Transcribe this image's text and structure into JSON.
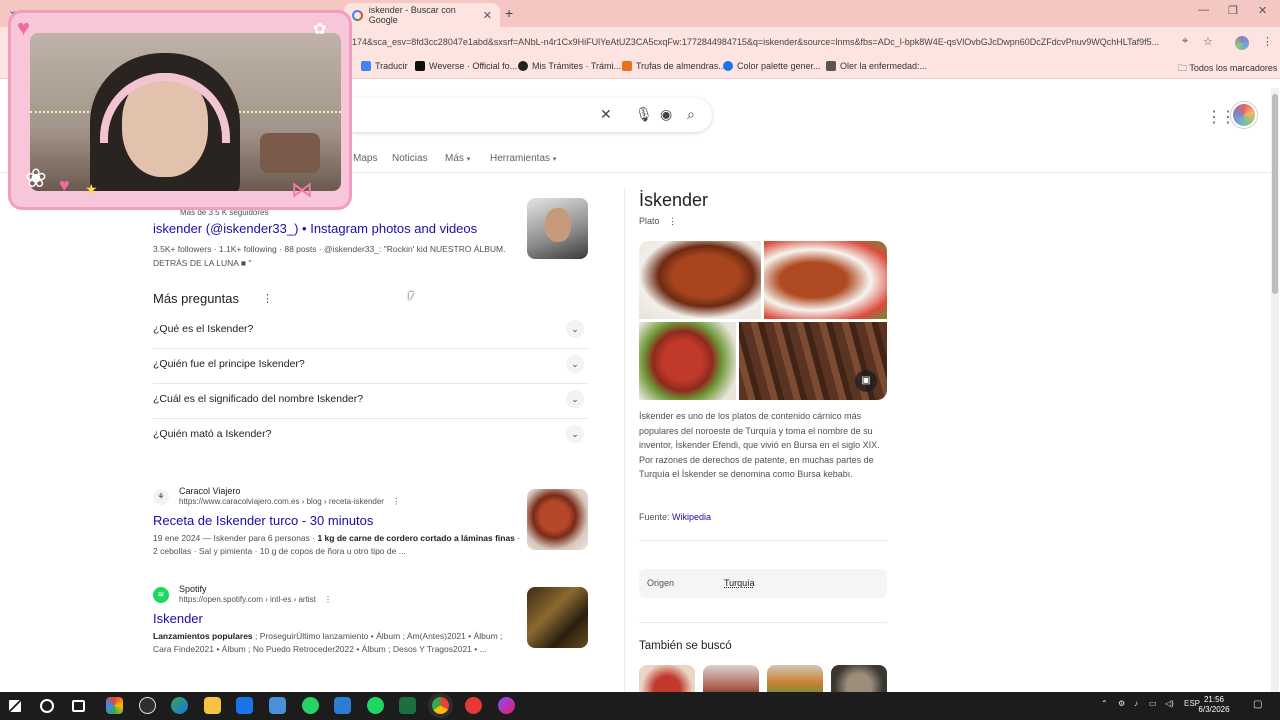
{
  "browser": {
    "tab_title": "iskender - Buscar con Google",
    "new_tab_icon": "plus-icon",
    "url": "174&sca_esv=8fd3cc28047e1abd&sxsrf=ANbL-n4r1Cx9HiFUlYeAtUZ3CA5cxqFw:1772844984715&q=iskender&source=lnms&fbs=ADc_l-bpk8W4E-qsVlOvbGJcDwpn60DcZFdcvPnuv9WQchHLTaf9f5...",
    "bookmarks": [
      {
        "label": "Traducir",
        "color": "#4285f4"
      },
      {
        "label": "Weverse · Official fo...",
        "color": "#111111"
      },
      {
        "label": "Mis Trámites · Trámi...",
        "color": "#222222"
      },
      {
        "label": "Trufas de almendras...",
        "color": "#e8711a"
      },
      {
        "label": "Color palette gener...",
        "color": "#1a73e8"
      },
      {
        "label": "Oler la enfermedad:...",
        "color": "#555555"
      }
    ],
    "all_bookmarks": "Todos los marcadores"
  },
  "search": {
    "tabs": [
      "Maps",
      "Noticias",
      "Más",
      "Herramientas"
    ]
  },
  "instagram_result": {
    "followers_line": "Más de 3.5 K seguidores",
    "title": "iskender (@iskender33_) • Instagram photos and videos",
    "meta": "3.5K+ followers · 1.1K+ following · 88 posts · @iskender33_: \"Rockin' kid NUESTRO ÁLBUM. DETRÁS DE LA LUNA ■ \""
  },
  "paa": {
    "heading": "Más preguntas",
    "questions": [
      "¿Qué es el Iskender?",
      "¿Quién fue el principe Iskender?",
      "¿Cuál es el significado del nombre Iskender?",
      "¿Quién mató a Iskender?"
    ]
  },
  "results": [
    {
      "site": "Caracol Viajero",
      "url": "https://www.caracolviajero.com.es › blog › receta-iskender",
      "title": "Receta de Iskender turco - 30 minutos",
      "date": "19 ene 2024 — ",
      "snippet_a": "Iskender para 6 personas · ",
      "snippet_b": "1 kg de carne de cordero cortado a láminas finas",
      "snippet_c": " · 2 cebollas · Sal y pimienta · 10 g de copos de ñora u otro tipo de ..."
    },
    {
      "site": "Spotify",
      "url": "https://open.spotify.com › intl-es › artist",
      "title": "Iskender",
      "snippet_b": "Lanzamientos populares",
      "snippet_c": " ; ProseguirÚltimo lanzamiento • Álbum ; Am(Antes)2021 • Álbum ; Cara Finde2021 • Álbum ; No Puedo Retroceder2022 • Álbum ; Desos Y Tragos2021 • ..."
    }
  ],
  "knowledge_panel": {
    "title": "İskender",
    "subtitle": "Plato",
    "description": "İskender es uno de los platos de contenido cárnico más populares del noroeste de Turquía y toma el nombre de su inventor, İskender Efendi, que vivió en Bursa en el siglo XIX. Por razones de derechos de patente, en muchas partes de Turquía el İskender se denomina como Bursa kebabı.",
    "source_label": "Fuente: ",
    "source_link": "Wikipedia",
    "origin_label": "Origen",
    "origin_value": "Turquía",
    "also_searched": "También se buscó"
  },
  "taskbar": {
    "time": "21:56",
    "date": "6/3/2026",
    "lang": "ESP"
  }
}
